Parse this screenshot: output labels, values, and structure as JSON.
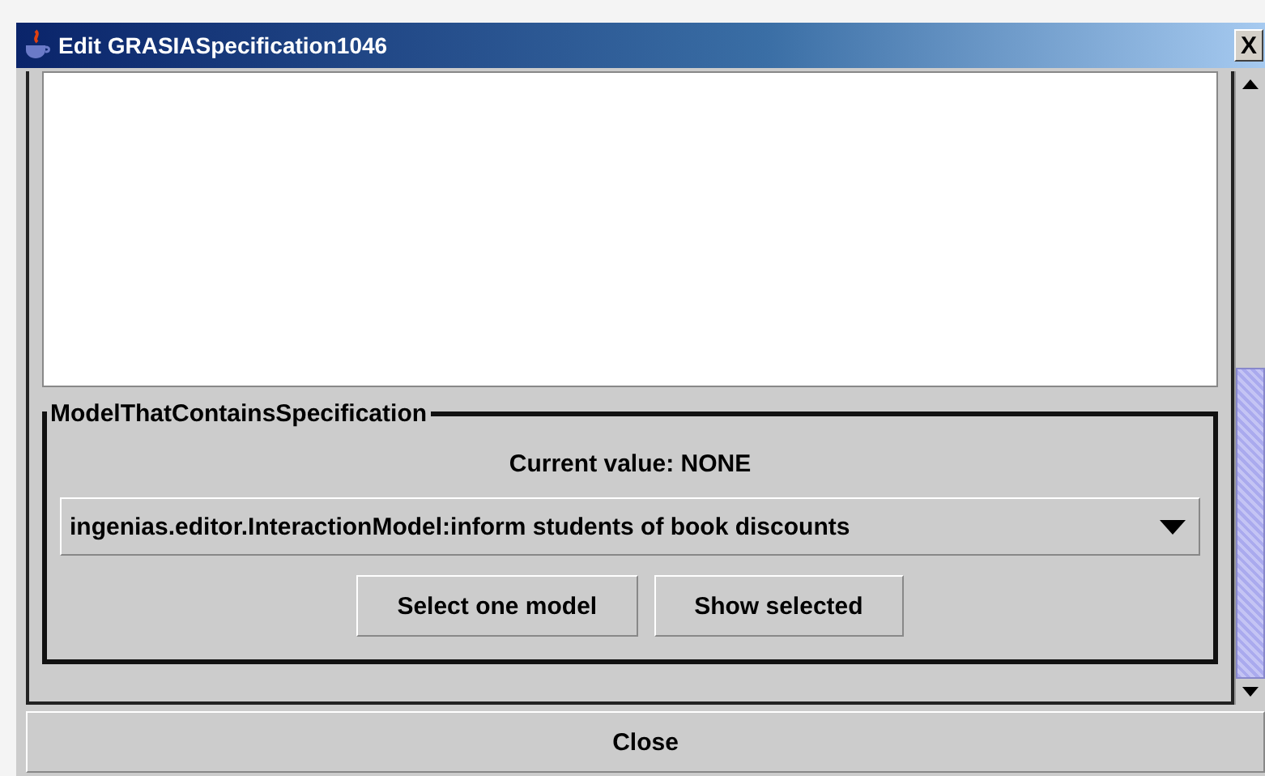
{
  "window": {
    "title": "Edit GRASIASpecification1046",
    "close_glyph": "X"
  },
  "group": {
    "title": "ModelThatContainsSpecification",
    "current_value": "Current value:  NONE",
    "dropdown": {
      "value": "ingenias.editor.InteractionModel:inform students of book discounts"
    },
    "buttons": [
      "Select one model",
      "Show selected"
    ]
  },
  "close_button": "Close"
}
